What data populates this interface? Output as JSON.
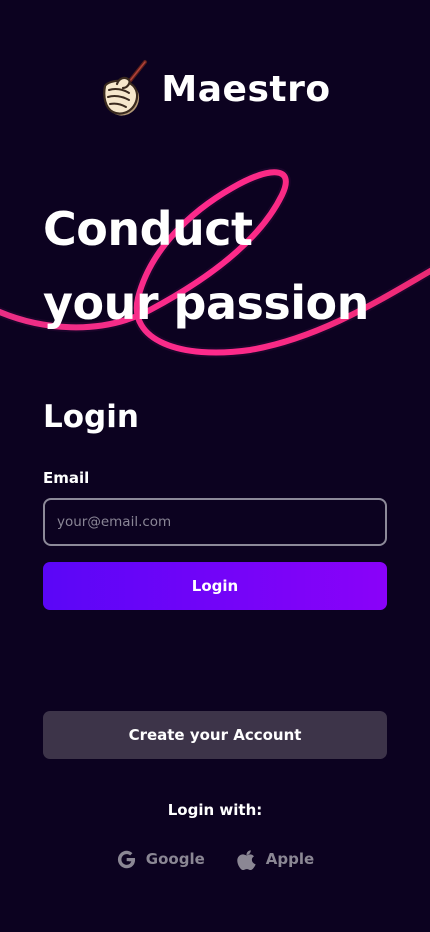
{
  "brand": {
    "name": "Maestro",
    "logo_icon": "conductor-hand-with-baton-icon"
  },
  "hero": {
    "line1": "Conduct",
    "line2": "your passion"
  },
  "login": {
    "title": "Login",
    "email_label": "Email",
    "email_placeholder": "your@email.com",
    "email_value": "",
    "submit_label": "Login"
  },
  "account": {
    "create_label": "Create your Account"
  },
  "social": {
    "heading": "Login with:",
    "providers": [
      {
        "label": "Google",
        "icon": "google-icon"
      },
      {
        "label": "Apple",
        "icon": "apple-icon"
      }
    ]
  },
  "colors": {
    "background": "#0c0220",
    "primary_gradient_start": "#5a06f7",
    "primary_gradient_end": "#8a02f9",
    "secondary_button": "#3d3449",
    "ribbon": "#f0287e",
    "muted_text": "#8b8794"
  }
}
